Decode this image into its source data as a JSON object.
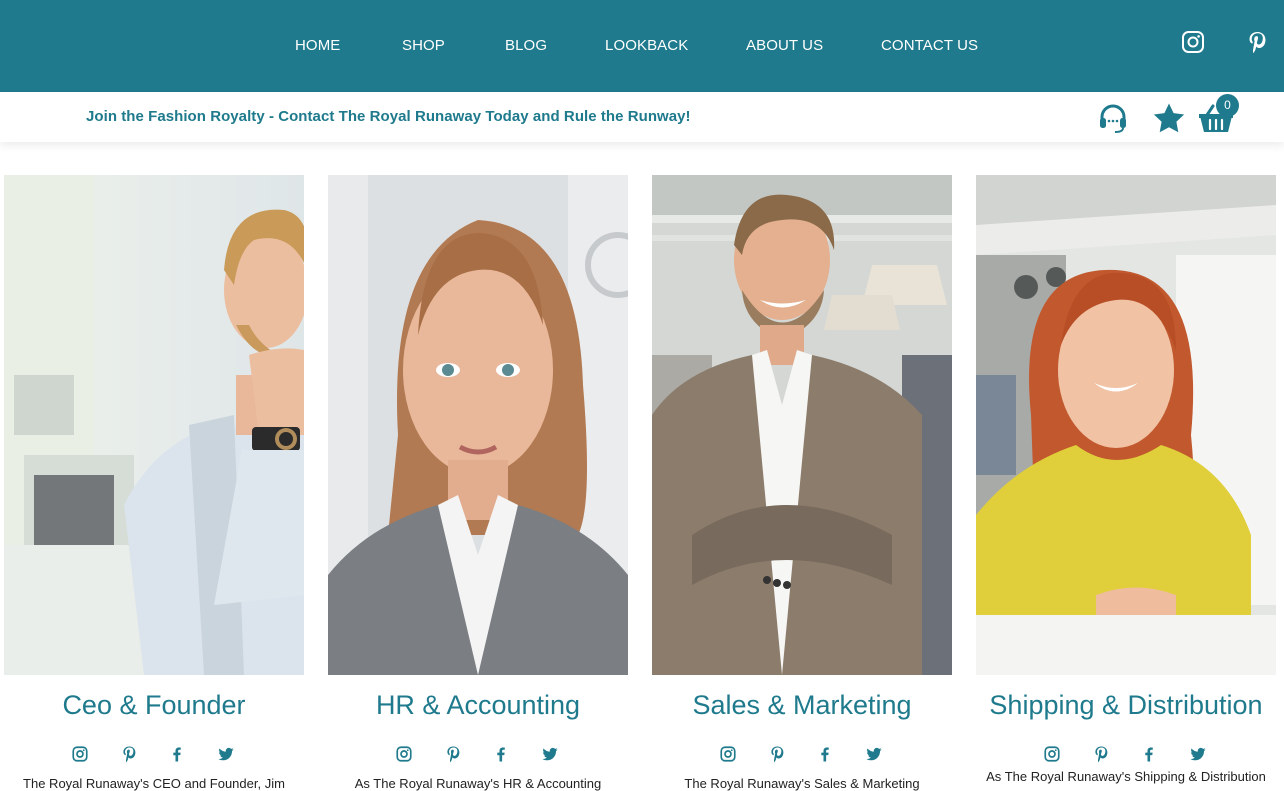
{
  "nav": {
    "items": [
      "HOME",
      "SHOP",
      "BLOG",
      "LOOKBACK",
      "ABOUT US",
      "CONTACT US"
    ],
    "social": [
      "instagram-icon",
      "pinterest-icon"
    ]
  },
  "subbar": {
    "tagline": "Join the Fashion Royalty - Contact The Royal Runaway Today and Rule the Runway!",
    "cart_count": "0"
  },
  "team": [
    {
      "title": "Ceo & Founder",
      "bio": "The Royal Runaway's CEO and Founder, Jim"
    },
    {
      "title": "HR & Accounting",
      "bio": "As The Royal Runaway's HR & Accounting"
    },
    {
      "title": "Sales & Marketing",
      "bio": "The Royal Runaway's Sales & Marketing"
    },
    {
      "title": "Shipping & Distribution",
      "bio": "As The Royal Runaway's Shipping & Distribution"
    }
  ],
  "colors": {
    "brand": "#1e7a8c",
    "nav_text": "#ffffff"
  }
}
